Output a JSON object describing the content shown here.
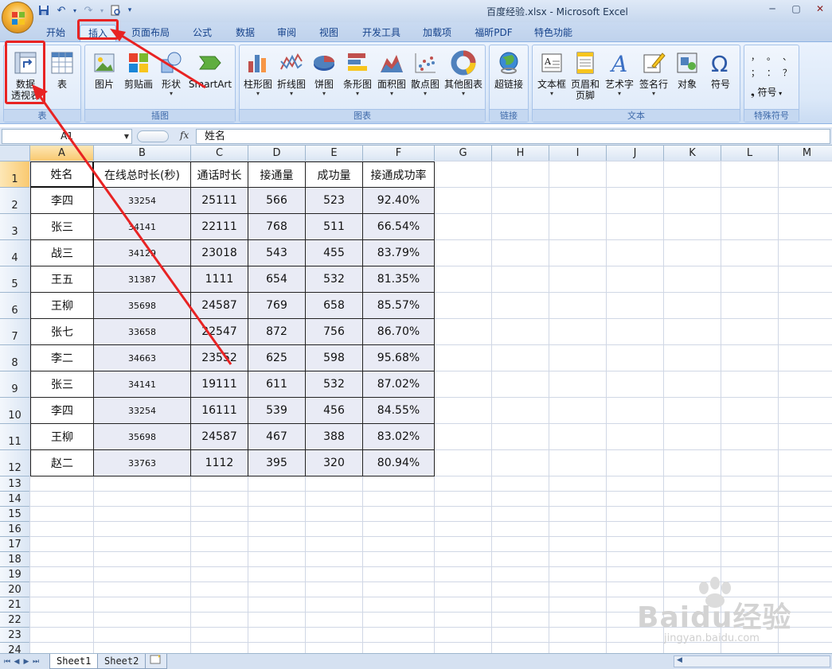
{
  "window": {
    "title": "百度经验.xlsx - Microsoft Excel"
  },
  "ribbon_tabs": [
    "开始",
    "插入",
    "页面布局",
    "公式",
    "数据",
    "审阅",
    "视图",
    "开发工具",
    "加载项",
    "福昕PDF",
    "特色功能"
  ],
  "active_tab": "插入",
  "ribbon": {
    "groups": {
      "tables": "表",
      "illustrations": "插图",
      "charts": "图表",
      "links": "链接",
      "text": "文本",
      "special": "特殊符号"
    },
    "buttons": {
      "pivot_line1": "数据",
      "pivot_line2": "透视表",
      "table": "表",
      "picture": "图片",
      "clipart": "剪贴画",
      "shapes": "形状",
      "smartart": "SmartArt",
      "column": "柱形图",
      "line": "折线图",
      "pie": "饼图",
      "bar": "条形图",
      "area": "面积图",
      "scatter": "散点图",
      "other_charts": "其他图表",
      "hyperlink": "超链接",
      "textbox": "文本框",
      "header_line1": "页眉和",
      "header_line2": "页脚",
      "wordart": "艺术字",
      "signature": "签名行",
      "object": "对象",
      "symbol": "符号",
      "symbol_dd": "符号"
    },
    "symbol_glyphs": [
      "，",
      "。",
      "、",
      "；",
      "：",
      "？"
    ]
  },
  "formula_bar": {
    "name_box": "A1",
    "fx": "fx",
    "content": "姓名"
  },
  "columns": [
    "A",
    "B",
    "C",
    "D",
    "E",
    "F",
    "G",
    "H",
    "I",
    "J",
    "K",
    "L",
    "M"
  ],
  "rows": [
    "1",
    "2",
    "3",
    "4",
    "5",
    "6",
    "7",
    "8",
    "9",
    "10",
    "11",
    "12",
    "13",
    "14",
    "15",
    "16",
    "17",
    "18",
    "19",
    "20",
    "21",
    "22",
    "23",
    "24"
  ],
  "table": {
    "headers": [
      "姓名",
      "在线总时长(秒)",
      "通话时长",
      "接通量",
      "成功量",
      "接通成功率"
    ],
    "rows": [
      [
        "李四",
        "33254",
        "25111",
        "566",
        "523",
        "92.40%"
      ],
      [
        "张三",
        "34141",
        "22111",
        "768",
        "511",
        "66.54%"
      ],
      [
        "战三",
        "34129",
        "23018",
        "543",
        "455",
        "83.79%"
      ],
      [
        "王五",
        "31387",
        "1111",
        "654",
        "532",
        "81.35%"
      ],
      [
        "王柳",
        "35698",
        "24587",
        "769",
        "658",
        "85.57%"
      ],
      [
        "张七",
        "33658",
        "22547",
        "872",
        "756",
        "86.70%"
      ],
      [
        "李二",
        "34663",
        "23552",
        "625",
        "598",
        "95.68%"
      ],
      [
        "张三",
        "34141",
        "19111",
        "611",
        "532",
        "87.02%"
      ],
      [
        "李四",
        "33254",
        "16111",
        "539",
        "456",
        "84.55%"
      ],
      [
        "王柳",
        "35698",
        "24587",
        "467",
        "388",
        "83.02%"
      ],
      [
        "赵二",
        "33763",
        "1112",
        "395",
        "320",
        "80.94%"
      ]
    ]
  },
  "sheet_tabs": [
    "Sheet1",
    "Sheet2"
  ],
  "active_sheet": "Sheet1",
  "watermark": {
    "main": "Baidu经验",
    "sub": "jingyan.baidu.com"
  },
  "colors": {
    "annotation_red": "#e82323",
    "selected_header": "#f9c970",
    "table_fill": "#e9ebf5"
  }
}
